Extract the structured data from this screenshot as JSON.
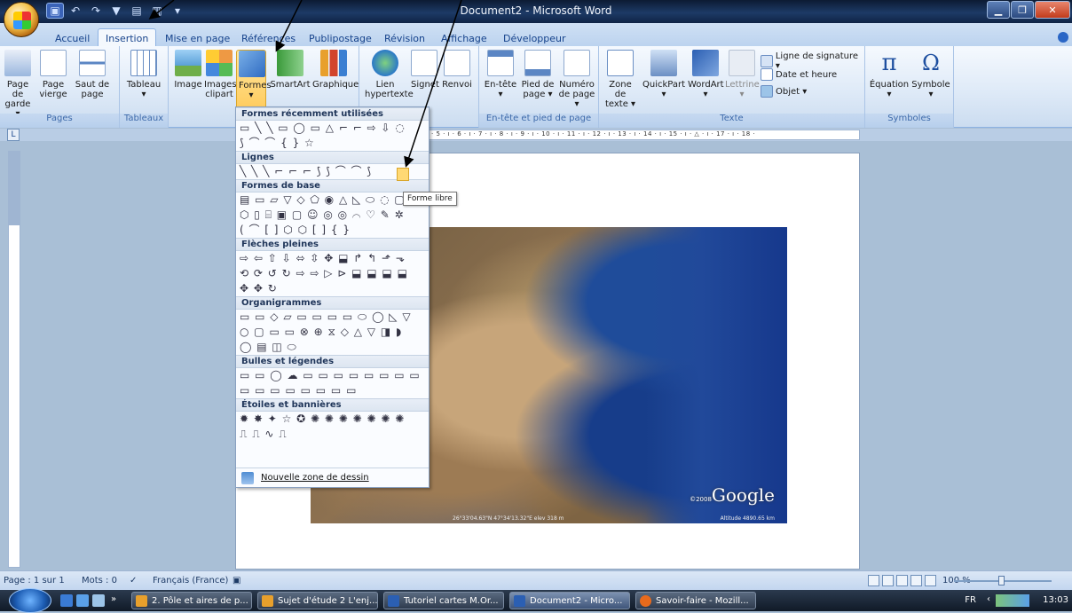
{
  "window": {
    "title": "Document2 - Microsoft Word"
  },
  "tabs": [
    "Accueil",
    "Insertion",
    "Mise en page",
    "Références",
    "Publipostage",
    "Révision",
    "Affichage",
    "Développeur"
  ],
  "ribbon": {
    "pages": {
      "label": "Pages",
      "b1": "Page de garde ▾",
      "b2": "Page vierge",
      "b3": "Saut de page"
    },
    "tableaux": {
      "label": "Tableaux",
      "b1": "Tableau ▾"
    },
    "illustrations": {
      "b1": "Image",
      "b2": "Images clipart",
      "b3": "Formes ▾",
      "b4": "SmartArt",
      "b5": "Graphique"
    },
    "liens": {
      "b1": "Lien hypertexte",
      "b2": "Signet",
      "b3": "Renvoi"
    },
    "entete": {
      "label": "En-tête et pied de page",
      "b1": "En-tête ▾",
      "b2": "Pied de page ▾",
      "b3": "Numéro de page ▾"
    },
    "texte": {
      "label": "Texte",
      "b1": "Zone de texte ▾",
      "b2": "QuickPart ▾",
      "b3": "WordArt ▾",
      "b4": "Lettrine ▾",
      "s1": "Ligne de signature ▾",
      "s2": "Date et heure",
      "s3": "Objet ▾"
    },
    "symboles": {
      "label": "Symboles",
      "b1": "Équation ▾",
      "b2": "Symbole ▾"
    }
  },
  "ruler": {
    "btn": "L",
    "ticks": "· 5 · ı · 6 · ı · 7 · ı · 8 · ı · 9 · ı · 10 · ı · 11 · ı · 12 · ı · 13 · ı · 14 · ı · 15 · ı · △ · ı · 17 · ı · 18 ·"
  },
  "shapes_menu": {
    "recent": "Formes récemment utilisées",
    "recent_row1": "▭ ╲ ╲ ▭ ◯ ▭ △ ⌐ ⌐ ⇨ ⇩ ◌",
    "recent_row2": "⟆ ⌒ ⌒ { } ☆",
    "lignes": "Lignes",
    "lignes_row": "╲ ╲ ╲ ⌐ ⌐ ⌐ ⟆ ⟆ ⌒ ⌒ ⟆",
    "base": "Formes de base",
    "base_row1": "▤ ▭ ▱ ▽ ◇ ⬠ ◉ △ ◺ ⬭ ◌ ▢",
    "base_row2": "⬡ ▯ ⌸ ▣ ▢ ☺ ◎ ◎ ⌒ ♡ ✎ ✲",
    "base_row3": "( ⌒ [ ] ⬡ ⬡ [ ] { }",
    "fleches": "Flèches pleines",
    "fleches_row1": "⇨ ⇦ ⇧ ⇩ ⬄ ⇳ ✥ ⬓ ↱ ↰ ⬏ ⬎",
    "fleches_row2": "⟲ ⟳ ↺ ↻ ⇨ ⇨ ▷ ⊳ ⬓ ⬓ ⬓ ⬓",
    "fleches_row3": "✥ ✥ ↻",
    "organigrammes": "Organigrammes",
    "org_row1": "▭ ▭ ◇ ▱ ▭ ▭ ▭ ▭ ⬭ ◯ ◺ ▽",
    "org_row2": "○ ▢ ▭ ▭ ⊗ ⊕ ⧖ ◇ △ ▽ ◨ ◗",
    "org_row3": "◯ ▤ ◫ ⬭",
    "bulles": "Bulles et légendes",
    "bulles_row1": "▭ ▭ ◯ ☁ ▭ ▭ ▭ ▭ ▭ ▭ ▭ ▭",
    "bulles_row2": "▭ ▭ ▭ ▭ ▭ ▭ ▭ ▭",
    "etoiles": "Étoiles et bannières",
    "etoiles_row1": "✹ ✸ ✦ ☆ ✪ ✺ ✺ ✺ ✺ ✺ ✺ ✺",
    "etoiles_row2": "⎍ ⎍ ∿ ⎍",
    "new_canvas": "Nouvelle zone de dessin"
  },
  "tooltip": "Forme libre",
  "map": {
    "watermark": "Google",
    "copyright": "©2008",
    "coords": "26°33'04.63\"N  47°34'13.32\"E  elev 318 m",
    "altitude": "Altitude 4890.65 km"
  },
  "status": {
    "page": "Page : 1 sur 1",
    "words": "Mots : 0",
    "language": "Français (France)",
    "zoom": "100 %"
  },
  "taskbar": {
    "items": [
      "2. Pôle et aires de p...",
      "Sujet d'étude 2 L'enj...",
      "Tutoriel cartes M.Or...",
      "Document2 - Micro...",
      "Savoir-faire - Mozill..."
    ],
    "lang": "FR",
    "clock": "13:03"
  },
  "colors": {
    "ribbon_blue": "#15428b",
    "accent_orange": "#ffcb5b",
    "title_dark": "#0c1b33"
  }
}
